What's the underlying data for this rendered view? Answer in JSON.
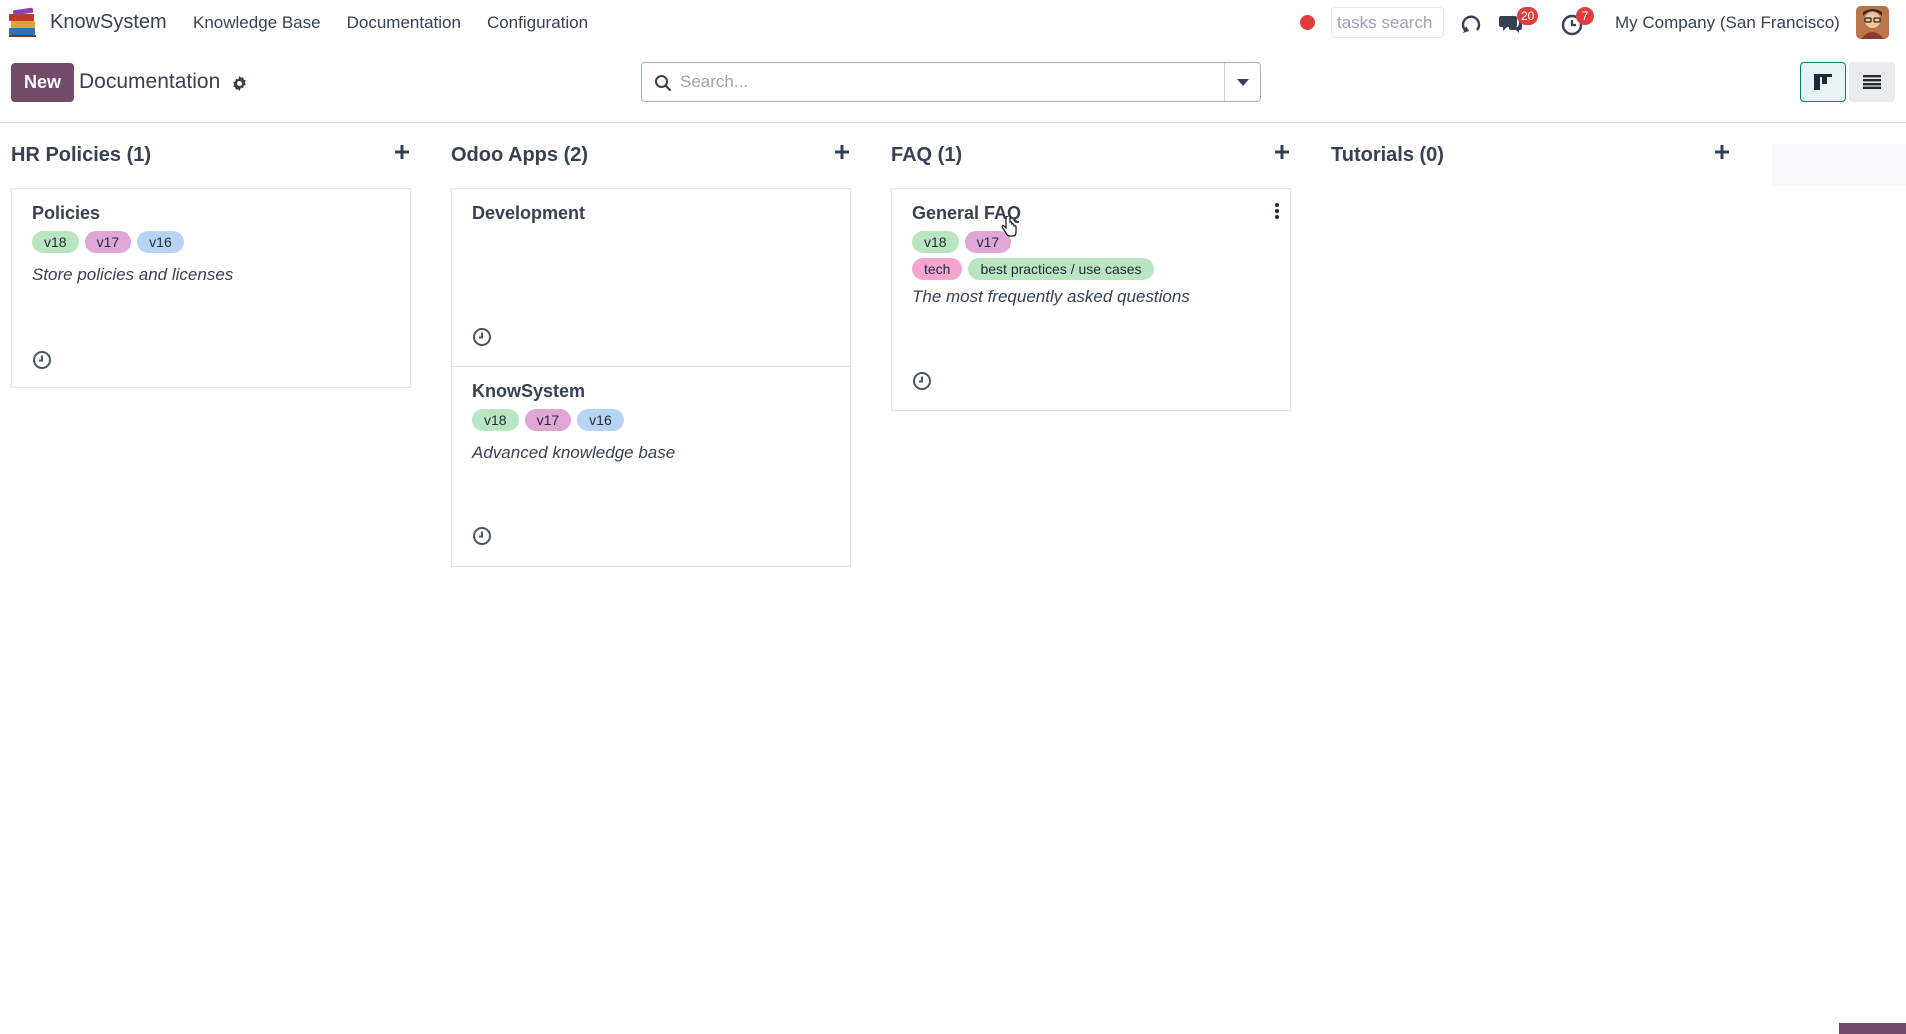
{
  "navbar": {
    "app_name": "KnowSystem",
    "menu": [
      "Knowledge Base",
      "Documentation",
      "Configuration"
    ],
    "tasks_search_placeholder": "tasks search",
    "messages_count": "20",
    "activities_count": "7",
    "company": "My Company (San Francisco)",
    "icons": [
      "books-logo-icon",
      "record-dot-icon",
      "sync-icon",
      "chat-icon",
      "clock-icon",
      "avatar"
    ]
  },
  "control_panel": {
    "new_label": "New",
    "title": "Documentation",
    "search_placeholder": "Search...",
    "views": [
      "kanban-view",
      "list-view"
    ]
  },
  "columns": [
    {
      "title": "HR Policies (1)",
      "cards": [
        {
          "title": "Policies",
          "tags": [
            "v18",
            "v17",
            "v16"
          ],
          "description": "Store policies and licenses"
        }
      ]
    },
    {
      "title": "Odoo Apps (2)",
      "cards": [
        {
          "title": "Development",
          "tags": [],
          "description": ""
        },
        {
          "title": "KnowSystem",
          "tags": [
            "v18",
            "v17",
            "v16"
          ],
          "description": "Advanced knowledge base"
        }
      ]
    },
    {
      "title": "FAQ (1)",
      "cards": [
        {
          "title": "General FAQ",
          "tags": [
            "v18",
            "v17"
          ],
          "tags2": [
            "tech",
            "best practices / use cases"
          ],
          "description": "The most frequently asked questions"
        }
      ]
    },
    {
      "title": "Tutorials (0)",
      "cards": []
    }
  ],
  "tag_colors": {
    "v18": "#b9e6c1",
    "v17": "#dfa6d6",
    "v16": "#b8d4f5",
    "tech": "#f5a6cf",
    "best practices / use cases": "#b9e6c1"
  },
  "colors": {
    "brand": "#714b67",
    "accent": "#017e84",
    "badge": "#e03e3e"
  }
}
